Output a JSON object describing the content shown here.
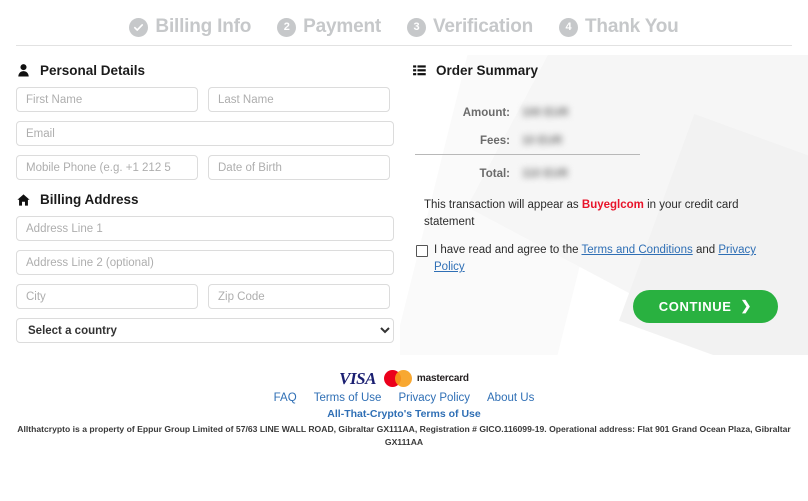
{
  "stepper": {
    "steps": [
      {
        "badge": "check",
        "label": "Billing Info"
      },
      {
        "badge": "2",
        "label": "Payment"
      },
      {
        "badge": "3",
        "label": "Verification"
      },
      {
        "badge": "4",
        "label": "Thank You"
      }
    ]
  },
  "personal_details": {
    "heading": "Personal Details",
    "icon": "user-icon",
    "fields": {
      "first_name": {
        "placeholder": "First Name",
        "value": ""
      },
      "last_name": {
        "placeholder": "Last Name",
        "value": ""
      },
      "email": {
        "placeholder": "Email",
        "value": ""
      },
      "mobile_phone": {
        "placeholder": "Mobile Phone (e.g. +1 212 5",
        "value": ""
      },
      "date_of_birth": {
        "placeholder": "Date of Birth",
        "value": ""
      }
    }
  },
  "billing_address": {
    "heading": "Billing Address",
    "icon": "home-icon",
    "fields": {
      "address_line_1": {
        "placeholder": "Address Line 1",
        "value": ""
      },
      "address_line_2": {
        "placeholder": "Address Line 2 (optional)",
        "value": ""
      },
      "city": {
        "placeholder": "City",
        "value": ""
      },
      "zip_code": {
        "placeholder": "Zip Code",
        "value": ""
      },
      "country": {
        "selected": "Select a country"
      }
    }
  },
  "order_summary": {
    "heading": "Order Summary",
    "icon": "list-icon",
    "rows": [
      {
        "label": "Amount:",
        "value": "100 EUR",
        "redacted": true
      },
      {
        "label": "Fees:",
        "value": "10 EUR",
        "redacted": true
      },
      {
        "label": "Total:",
        "value": "110 EUR",
        "redacted": true
      }
    ]
  },
  "statement": {
    "prefix": "This transaction will appear as",
    "merchant": "Buyeglcom",
    "merchant_color": "#e8142a",
    "suffix": "in your credit card statement"
  },
  "agreement": {
    "checked": false,
    "prefix": "I have read and agree to the",
    "terms_link": "Terms and Conditions",
    "conjunction": "and",
    "privacy_link": "Privacy Policy"
  },
  "cta": {
    "label": "CONTINUE",
    "chevron": "❯",
    "color": "#29b140"
  },
  "footer": {
    "cards": [
      {
        "name": "visa-logo",
        "text": "VISA"
      },
      {
        "name": "mastercard-logo",
        "text": "mastercard"
      }
    ],
    "links": [
      "FAQ",
      "Terms of Use",
      "Privacy Policy",
      "About Us"
    ],
    "sub_link": "All-That-Crypto's Terms of Use",
    "legal": "Allthatcrypto is a property of Eppur Group Limited of 57/63 LINE WALL ROAD, Gibraltar GX111AA, Registration # GICO.116099-19. Operational address: Flat 901 Grand Ocean Plaza, Gibraltar GX111AA"
  }
}
